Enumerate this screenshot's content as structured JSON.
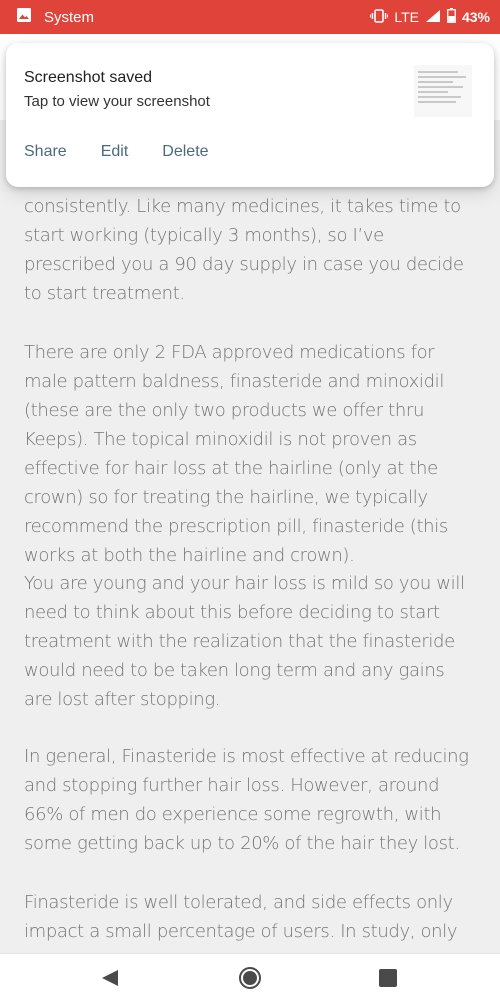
{
  "status_bar": {
    "app_name": "System",
    "network": "LTE",
    "battery": "43%",
    "color": "#e0433a"
  },
  "notification": {
    "title": "Screenshot saved",
    "body": "Tap to view your screenshot",
    "actions": [
      "Share",
      "Edit",
      "Delete"
    ]
  },
  "article": {
    "paragraphs": [
      "consistently. Like many medicines, it takes time to start working (typically 3 months), so I’ve prescribed you a 90 day supply in case you decide to start treatment.",
      "There are only 2 FDA approved medications for male pattern baldness, finasteride and minoxidil (these are the only two products we offer thru Keeps). The topical minoxidil is not proven as effective for hair loss at the hairline (only at the crown) so for treating the hairline, we typically recommend the prescription pill, finasteride (this works at both the hairline and crown).",
      "You are young and your hair loss is mild so you will need to think about this before deciding to start treatment with the realization that the finasteride would need to be taken long term and any gains are lost after stopping.",
      "In general, Finasteride is most effective at reducing and stopping further hair loss. However, around 66% of men do experience some regrowth, with some getting back up to 20% of the hair they lost.",
      "Finasteride is well tolerated, and side effects only impact a small percentage of users. In study, only"
    ]
  },
  "nav_bar": {
    "icons": [
      "back-icon",
      "home-icon",
      "recents-icon"
    ]
  }
}
